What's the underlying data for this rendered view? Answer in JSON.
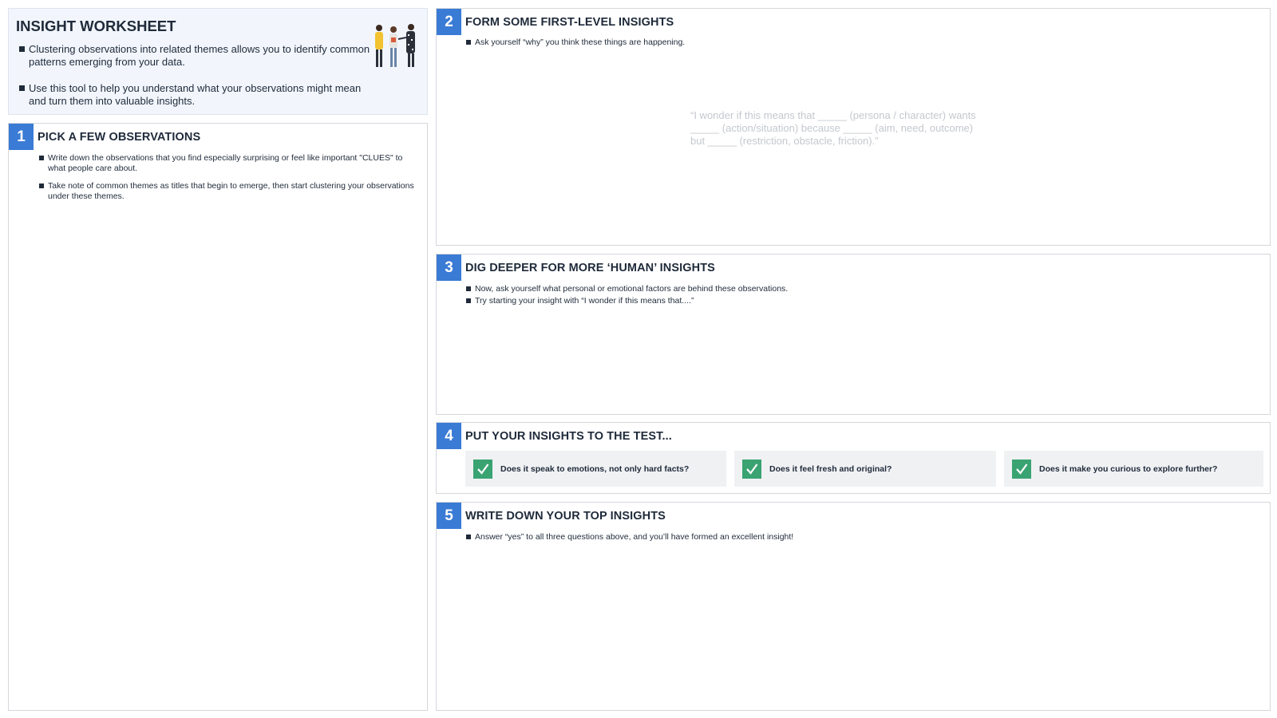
{
  "intro": {
    "title": "INSIGHT WORKSHEET",
    "bullets": [
      "Clustering observations into related themes allows you to identify common patterns emerging from your data.",
      "Use this tool to help you understand what your observations might mean and turn them into valuable insights."
    ]
  },
  "panels": {
    "p1": {
      "number": "1",
      "title": "PICK A FEW OBSERVATIONS",
      "bullets": [
        "Write down the observations that you find especially surprising or feel like important \"CLUES\" to what people care about.",
        "Take note of common themes as titles that begin to emerge, then start clustering your observations under these themes."
      ]
    },
    "p2": {
      "number": "2",
      "title": "FORM SOME FIRST-LEVEL INSIGHTS",
      "bullets": [
        "Ask yourself “why” you think these things are happening."
      ],
      "hint": "“I wonder if this means that _____ (persona / character) wants _____ (action/situation) because _____ (aim, need, outcome) but _____ (restriction, obstacle, friction).”"
    },
    "p3": {
      "number": "3",
      "title": "DIG DEEPER FOR MORE ‘HUMAN’ INSIGHTS",
      "bullets": [
        "Now, ask yourself what personal or emotional factors are behind these observations.",
        "Try starting your insight with “I wonder if this means that....”"
      ]
    },
    "p4": {
      "number": "4",
      "title": "PUT YOUR INSIGHTS TO THE TEST...",
      "checks": [
        "Does it speak to emotions, not only hard facts?",
        "Does it feel fresh and original?",
        "Does it make you curious to explore further?"
      ]
    },
    "p5": {
      "number": "5",
      "title": "WRITE DOWN YOUR TOP INSIGHTS",
      "bullets": [
        "Answer “yes” to all three questions above, and you’ll have formed an excellent insight!"
      ]
    }
  },
  "colors": {
    "accent_blue": "#3a7bd5",
    "check_green": "#3aa372",
    "intro_bg": "#f2f6fc",
    "text_dark": "#1f2a3a",
    "hint_gray": "#c4c8ce"
  },
  "icons": {
    "illustration": "people-group-illustration",
    "check": "checkmark-icon"
  }
}
